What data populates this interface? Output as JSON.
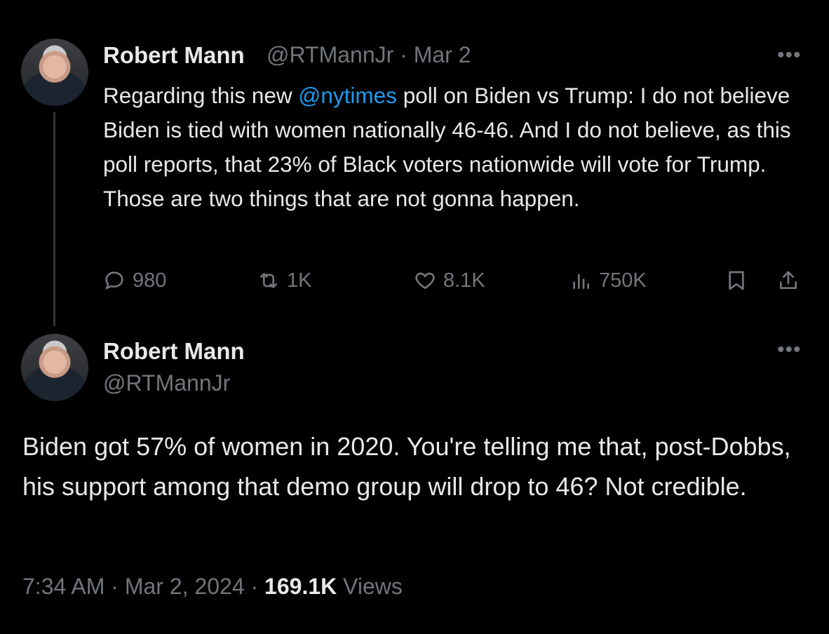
{
  "tweet1": {
    "name": "Robert Mann",
    "handle": "@RTMannJr",
    "separator": "·",
    "date": "Mar 2",
    "text_before": "Regarding this new ",
    "mention": "@nytimes",
    "text_after": " poll on Biden vs Trump: I do not believe Biden is tied with women nationally 46-46. And I do not believe, as this poll reports, that 23% of Black voters nationwide will vote for Trump. Those are two things that are not gonna happen.",
    "replies": "980",
    "reposts": "1K",
    "likes": "8.1K",
    "views": "750K"
  },
  "tweet2": {
    "name": "Robert Mann",
    "handle": "@RTMannJr",
    "text": "Biden got 57% of women in 2020. You're telling me that, post-Dobbs, his support among that demo group will drop to 46? Not credible.",
    "time": "7:34 AM",
    "sep1": "·",
    "date": "Mar 2, 2024",
    "sep2": "·",
    "views_count": "169.1K",
    "views_label": "Views"
  },
  "more_label": "•••",
  "colors": {
    "background": "#000000",
    "text": "#e7e9ea",
    "secondary": "#71767b",
    "accent": "#1d9bf0"
  },
  "icons": [
    "more-icon",
    "reply-icon",
    "repost-icon",
    "like-icon",
    "views-icon",
    "bookmark-icon",
    "share-icon"
  ]
}
